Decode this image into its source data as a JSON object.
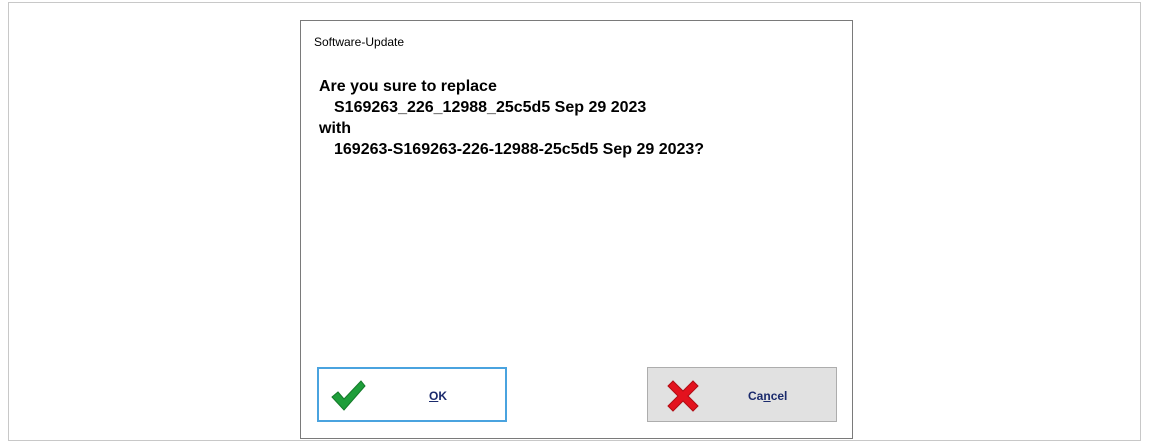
{
  "dialog": {
    "title": "Software-Update",
    "message": {
      "line1": "Are you sure to replace",
      "line2": "S169263_226_12988_25c5d5 Sep 29 2023",
      "line3": "with",
      "line4": "169263-S169263-226-12988-25c5d5 Sep 29 2023?"
    },
    "buttons": {
      "ok": {
        "mnemonic": "O",
        "rest": "K",
        "icon": "checkmark-icon"
      },
      "cancel": {
        "pre": "Ca",
        "mnemonic": "n",
        "rest": "cel",
        "icon": "cross-icon"
      }
    }
  },
  "colors": {
    "ok_focus_border": "#4aa3df",
    "check_green": "#1e9e3a",
    "cross_red": "#e3121e",
    "button_text": "#1a2a6c"
  }
}
